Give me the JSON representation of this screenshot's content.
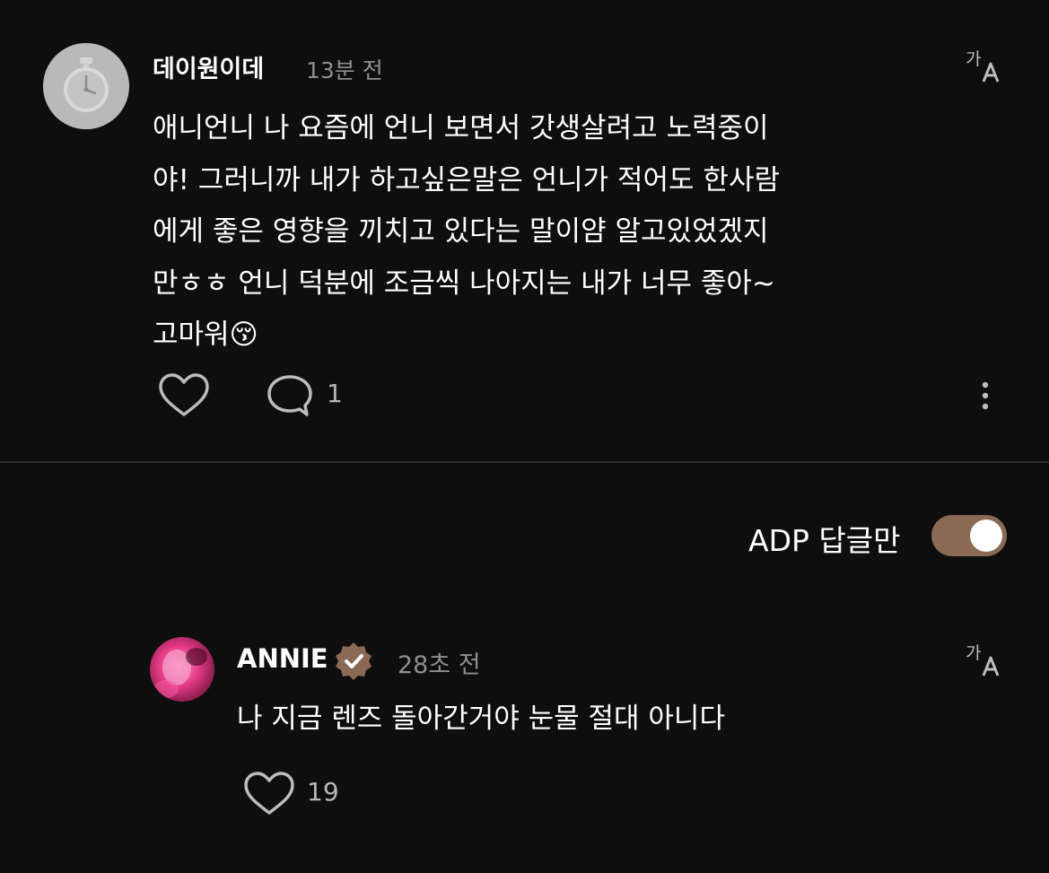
{
  "comment": {
    "username": "데이원이데",
    "time": "13분 전",
    "text": "애니언니 나 요즘에 언니 보면서 갓생살려고 노력중이\n야! 그러니까 내가 하고싶은말은 언니가 적어도 한사람\n에게 좋은 영향을 끼치고 있다는 말이얌 알고있었겠지\n만ㅎㅎ 언니 덕분에 조금씩 나아지는 내가 너무 좋아~\n고마워😚",
    "reply_count": "1",
    "avatar_icon": "stopwatch-icon"
  },
  "filter": {
    "label": "ADP 답글만",
    "enabled": true
  },
  "reply": {
    "username": "ANNIE",
    "time": "28초 전",
    "text": "나 지금 렌즈 돌아간거야 눈물 절대 아니다",
    "like_count": "19",
    "verified": true
  },
  "colors": {
    "background": "#0f0e0e",
    "accent": "#8b6a55",
    "muted_text": "#8e8e8e",
    "divider": "#2c2c2c"
  },
  "icons": [
    "translate-icon",
    "heart-icon",
    "comment-bubble-icon",
    "more-vertical-icon",
    "verified-badge-icon"
  ]
}
